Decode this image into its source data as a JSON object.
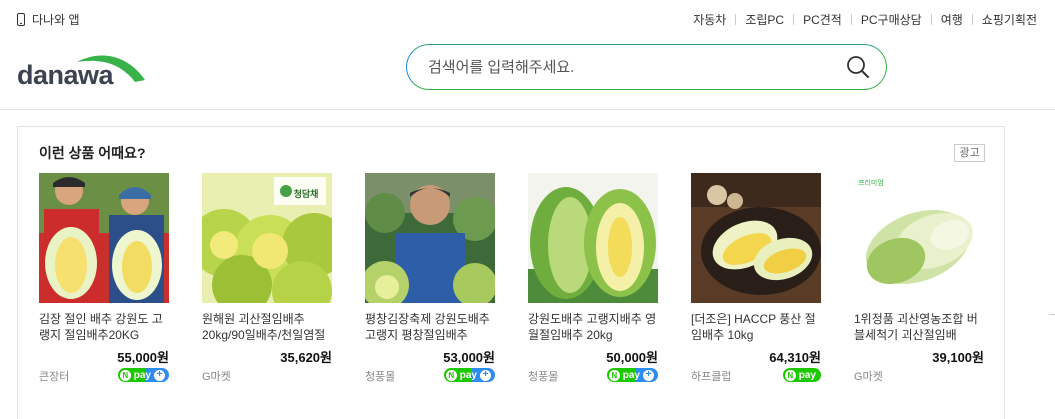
{
  "topbar": {
    "app_label": "다나와 앱",
    "nav": [
      "자동차",
      "조립PC",
      "PC견적",
      "PC구매상담",
      "여행",
      "쇼핑기획전"
    ]
  },
  "header": {
    "logo_text": "danawa",
    "search_placeholder": "검색어를 입력해주세요."
  },
  "recommend": {
    "title": "이런 상품 어때요?",
    "ad_label": "광고",
    "products": [
      {
        "name": "김장 절인 배추 강원도 고랭지 절임배추20KG",
        "price": "55,000원",
        "seller": "큰장터",
        "npay": true,
        "npay_plus": true
      },
      {
        "name": "원해원 괴산절임배추20kg/90일배추/천일염절임/",
        "price": "35,620원",
        "seller": "G마켓",
        "npay": false,
        "npay_plus": false
      },
      {
        "name": "평창김장축제 강원도배추 고랭지 평창절임배추",
        "price": "53,000원",
        "seller": "청풍몰",
        "npay": true,
        "npay_plus": true
      },
      {
        "name": "강원도배추 고랭지배추 영월절임배추 20kg",
        "price": "50,000원",
        "seller": "청풍몰",
        "npay": true,
        "npay_plus": true
      },
      {
        "name": "[더조은] HACCP 풍산 절임배추 10kg",
        "price": "64,310원",
        "seller": "하프클럽",
        "npay": true,
        "npay_plus": false
      },
      {
        "name": "1위정품 괴산영농조합 버블세척기 괴산절임배",
        "price": "39,100원",
        "seller": "G마켓",
        "npay": false,
        "npay_plus": false
      }
    ],
    "npay_text": "pay",
    "image_labels": [
      "청담채",
      "프리미엄"
    ]
  },
  "colors": {
    "brand_green": "#3ab24a",
    "brand_blue": "#1d8fd0",
    "npay_green": "#1ec800",
    "npay_blue": "#2d8cf0"
  }
}
